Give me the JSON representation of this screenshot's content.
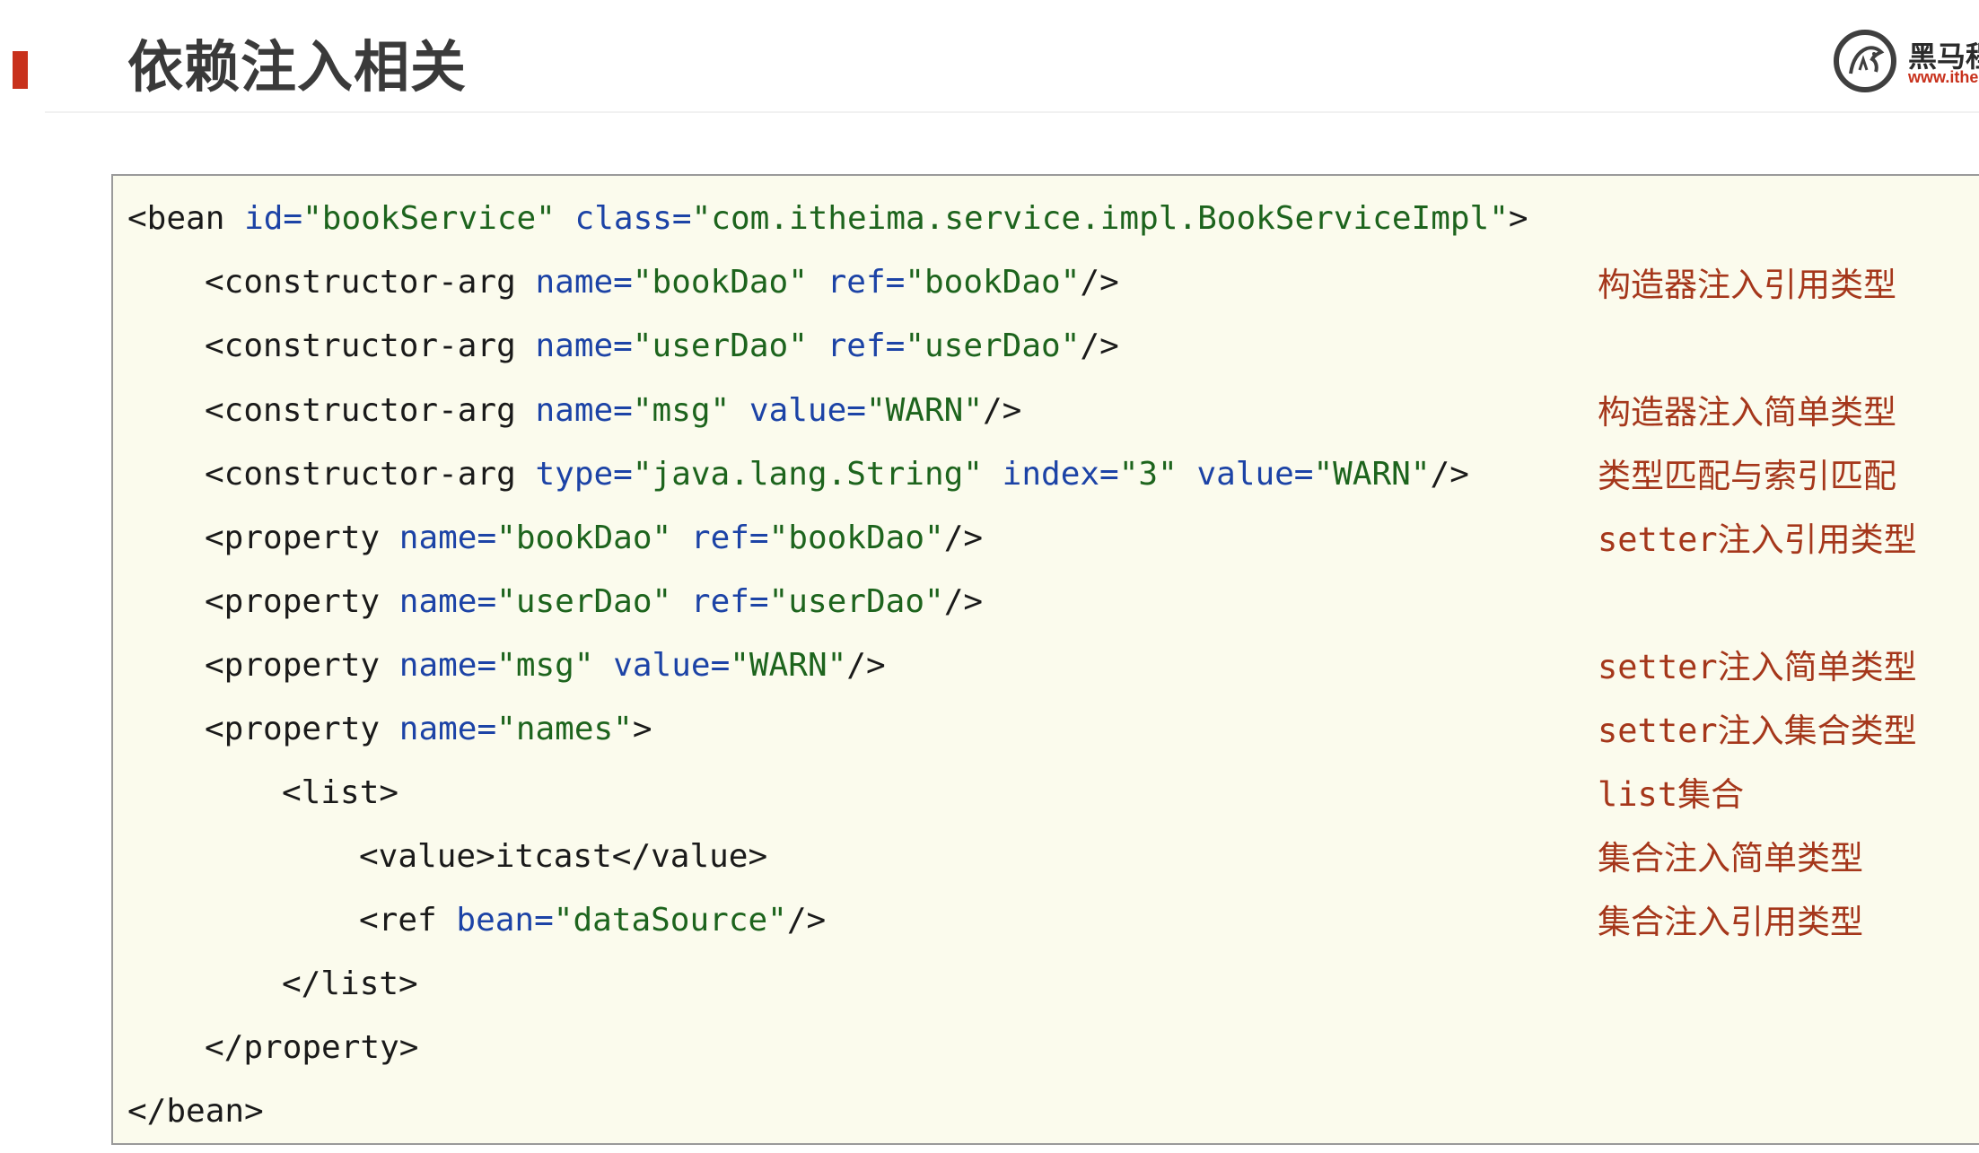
{
  "header": {
    "title": "依赖注入相关",
    "logo_cn": "黑马程",
    "logo_url": "www.ithei"
  },
  "colors": {
    "accent": "#c8311c",
    "tag": "#1a1a1a",
    "attribute": "#1c43a6",
    "string": "#1d641d",
    "annotation": "#a5371b",
    "panel_background": "#fbfbed"
  },
  "code": {
    "lines": [
      {
        "bean_open": "<bean",
        "id_attr": "id=",
        "id_value": "\"bookService\"",
        "class_attr": "class=",
        "class_value": "\"com.itheima.service.impl.BookServiceImpl\"",
        "close": ">"
      },
      {
        "tag": "<constructor-arg",
        "attr1": "name=",
        "val1": "\"bookDao\"",
        "attr2": "ref=",
        "val2": "\"bookDao\"",
        "end": "/>"
      },
      {
        "tag": "<constructor-arg",
        "attr1": "name=",
        "val1": "\"userDao\"",
        "attr2": "ref=",
        "val2": "\"userDao\"",
        "end": "/>"
      },
      {
        "tag": "<constructor-arg",
        "attr1": "name=",
        "val1": "\"msg\"",
        "attr2": "value=",
        "val2": "\"WARN\"",
        "end": "/>"
      },
      {
        "tag": "<constructor-arg",
        "attr1": "type=",
        "val1": "\"java.lang.String\"",
        "attr2": "index=",
        "val2": "\"3\"",
        "attr3": "value=",
        "val3": "\"WARN\"",
        "end": "/>"
      },
      {
        "tag": "<property",
        "attr1": "name=",
        "val1": "\"bookDao\"",
        "attr2": "ref=",
        "val2": "\"bookDao\"",
        "end": "/>"
      },
      {
        "tag": "<property",
        "attr1": "name=",
        "val1": "\"userDao\"",
        "attr2": "ref=",
        "val2": "\"userDao\"",
        "end": "/>"
      },
      {
        "tag": "<property",
        "attr1": "name=",
        "val1": "\"msg\"",
        "attr2": "value=",
        "val2": "\"WARN\"",
        "end": "/>"
      },
      {
        "tag": "<property",
        "attr1": "name=",
        "val1": "\"names\"",
        "end": ">"
      },
      {
        "text": "<list>"
      },
      {
        "open": "<value>",
        "content": "itcast",
        "close": "</value>"
      },
      {
        "tag": "<ref",
        "attr1": "bean=",
        "val1": "\"dataSource\"",
        "end": "/>"
      },
      {
        "text": "</list>"
      },
      {
        "text": "</property>"
      },
      {
        "text": "</bean>"
      }
    ]
  },
  "annotations": [
    "构造器注入引用类型",
    "构造器注入简单类型",
    "类型匹配与索引匹配",
    "setter注入引用类型",
    "setter注入简单类型",
    "setter注入集合类型",
    "list集合",
    "集合注入简单类型",
    "集合注入引用类型"
  ]
}
